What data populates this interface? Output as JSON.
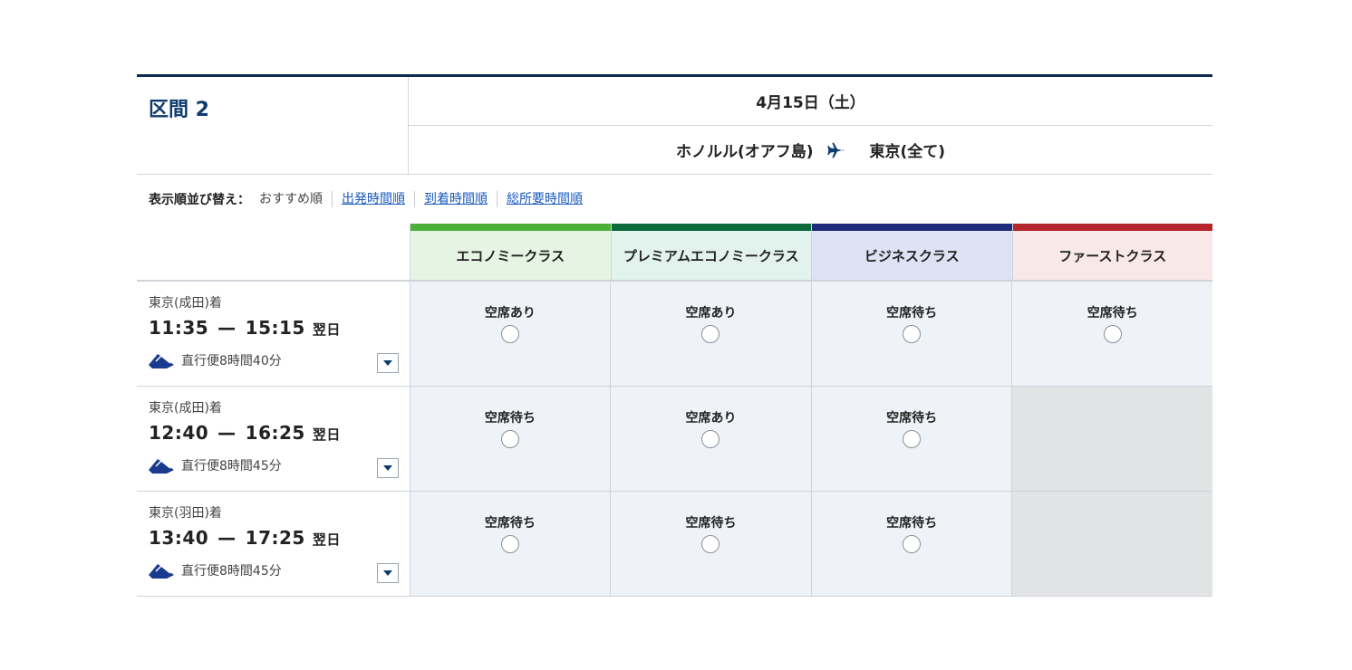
{
  "segment": {
    "title": "区間 2",
    "date": "4月15日（土）",
    "origin": "ホノルル(オアフ島)",
    "destination": "東京(全て)"
  },
  "sort": {
    "label": "表示順並び替え：",
    "current": "おすすめ順",
    "options": [
      "出発時間順",
      "到着時間順",
      "総所要時間順"
    ]
  },
  "classes": [
    {
      "name": "エコノミークラス",
      "bar_color": "#4caf3a",
      "bg_color": "#e6f5e3"
    },
    {
      "name": "プレミアムエコノミークラス",
      "bar_color": "#0c6b3b",
      "bg_color": "#e1f3ec"
    },
    {
      "name": "ビジネスクラス",
      "bar_color": "#1d2b7a",
      "bg_color": "#dde3f4"
    },
    {
      "name": "ファーストクラス",
      "bar_color": "#b3262c",
      "bg_color": "#f9e8e8"
    }
  ],
  "flights": [
    {
      "arrival": "東京(成田)着",
      "depart": "11:35",
      "dash": "—",
      "arrive": "15:15",
      "next_day": "翌日",
      "duration": "直行便8時間40分",
      "availability": [
        "空席あり",
        "空席あり",
        "空席待ち",
        "空席待ち"
      ]
    },
    {
      "arrival": "東京(成田)着",
      "depart": "12:40",
      "dash": "—",
      "arrive": "16:25",
      "next_day": "翌日",
      "duration": "直行便8時間45分",
      "availability": [
        "空席待ち",
        "空席あり",
        "空席待ち",
        ""
      ]
    },
    {
      "arrival": "東京(羽田)着",
      "depart": "13:40",
      "dash": "—",
      "arrive": "17:25",
      "next_day": "翌日",
      "duration": "直行便8時間45分",
      "availability": [
        "空席待ち",
        "空席待ち",
        "空席待ち",
        ""
      ]
    }
  ]
}
